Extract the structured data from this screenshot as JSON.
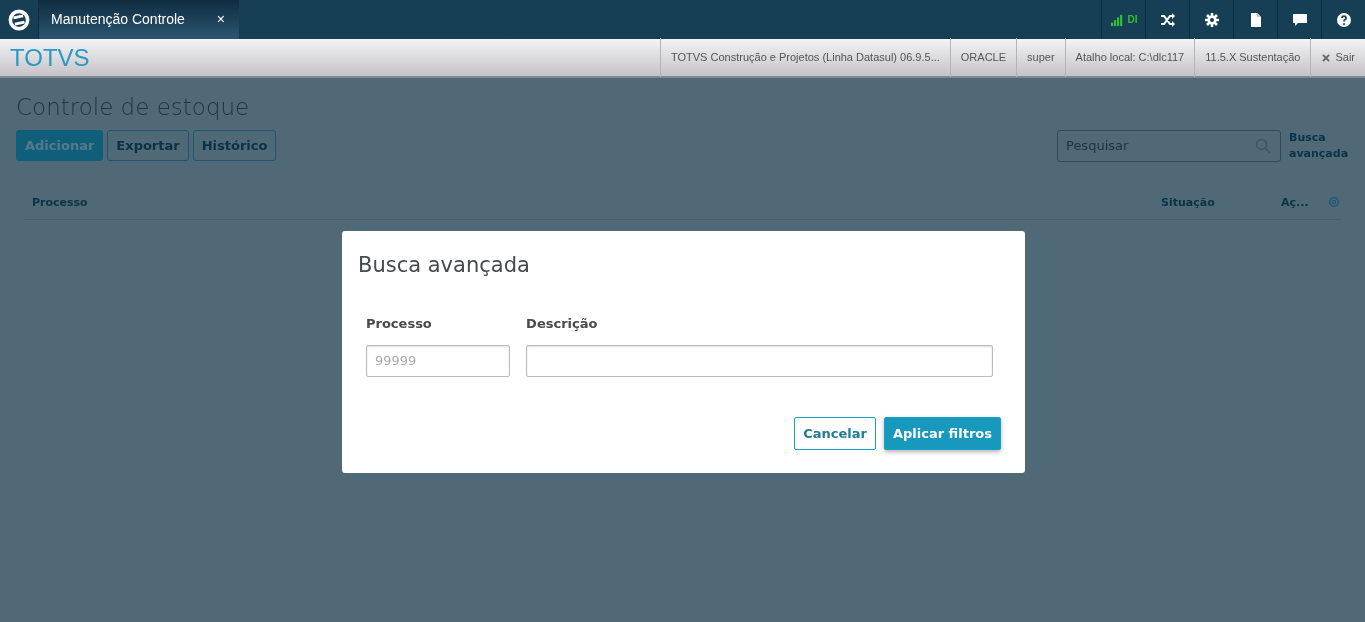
{
  "tabs": [
    {
      "label": "Manutenção Controle",
      "close": "×",
      "selected": true
    }
  ],
  "status_icons": {
    "connection": "DI"
  },
  "app_bar": {
    "logo": "TOTVS",
    "info": [
      "TOTVS Construção e Projetos (Linha Datasul) 06.9.5...",
      "ORACLE",
      "super",
      "Atalho local: C:\\dlc117",
      "11.5.X Sustentação"
    ],
    "logout": "Sair"
  },
  "page": {
    "title": "Controle de estoque",
    "actions": [
      {
        "label": "Adicionar",
        "kind": "primary"
      },
      {
        "label": "Exportar",
        "kind": "secondary"
      },
      {
        "label": "Histórico",
        "kind": "secondary"
      }
    ],
    "search": {
      "placeholder": "Pesquisar"
    },
    "advanced_search_link": "Busca avançada"
  },
  "table": {
    "columns": [
      "Processo",
      "Situação",
      "Aç..."
    ]
  },
  "dialog": {
    "title": "Busca avançada",
    "fields": [
      {
        "label": "Processo",
        "placeholder": "99999"
      },
      {
        "label": "Descrição"
      }
    ],
    "buttons": [
      {
        "label": "Cancelar",
        "kind": "secondary"
      },
      {
        "label": "Aplicar filtros",
        "kind": "primary"
      }
    ]
  }
}
